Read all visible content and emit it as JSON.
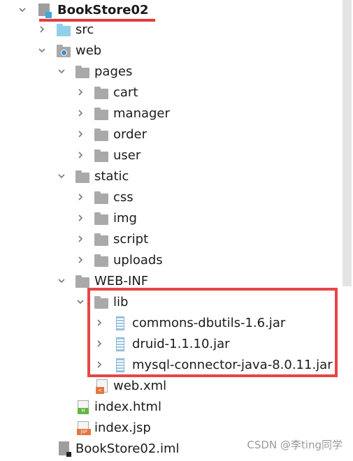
{
  "tree": {
    "project": "BookStore02",
    "src": "src",
    "web": "web",
    "pages": "pages",
    "cart": "cart",
    "manager": "manager",
    "order": "order",
    "user": "user",
    "static": "static",
    "css": "css",
    "img": "img",
    "script": "script",
    "uploads": "uploads",
    "webinf": "WEB-INF",
    "lib": "lib",
    "jar1": "commons-dbutils-1.6.jar",
    "jar2": "druid-1.1.10.jar",
    "jar3": "mysql-connector-java-8.0.11.jar",
    "webxml": "web.xml",
    "indexhtml": "index.html",
    "indexjsp": "index.jsp",
    "iml": "BookStore02.iml"
  },
  "badges": {
    "html": "H",
    "jsp": "JSP",
    "xml": "<"
  },
  "watermark": "CSDN @李ting同学",
  "colors": {
    "highlight": "#e64646",
    "folder": "#a9a9a9",
    "source_folder": "#8fd1ec",
    "jar": "#9cc7e6"
  }
}
